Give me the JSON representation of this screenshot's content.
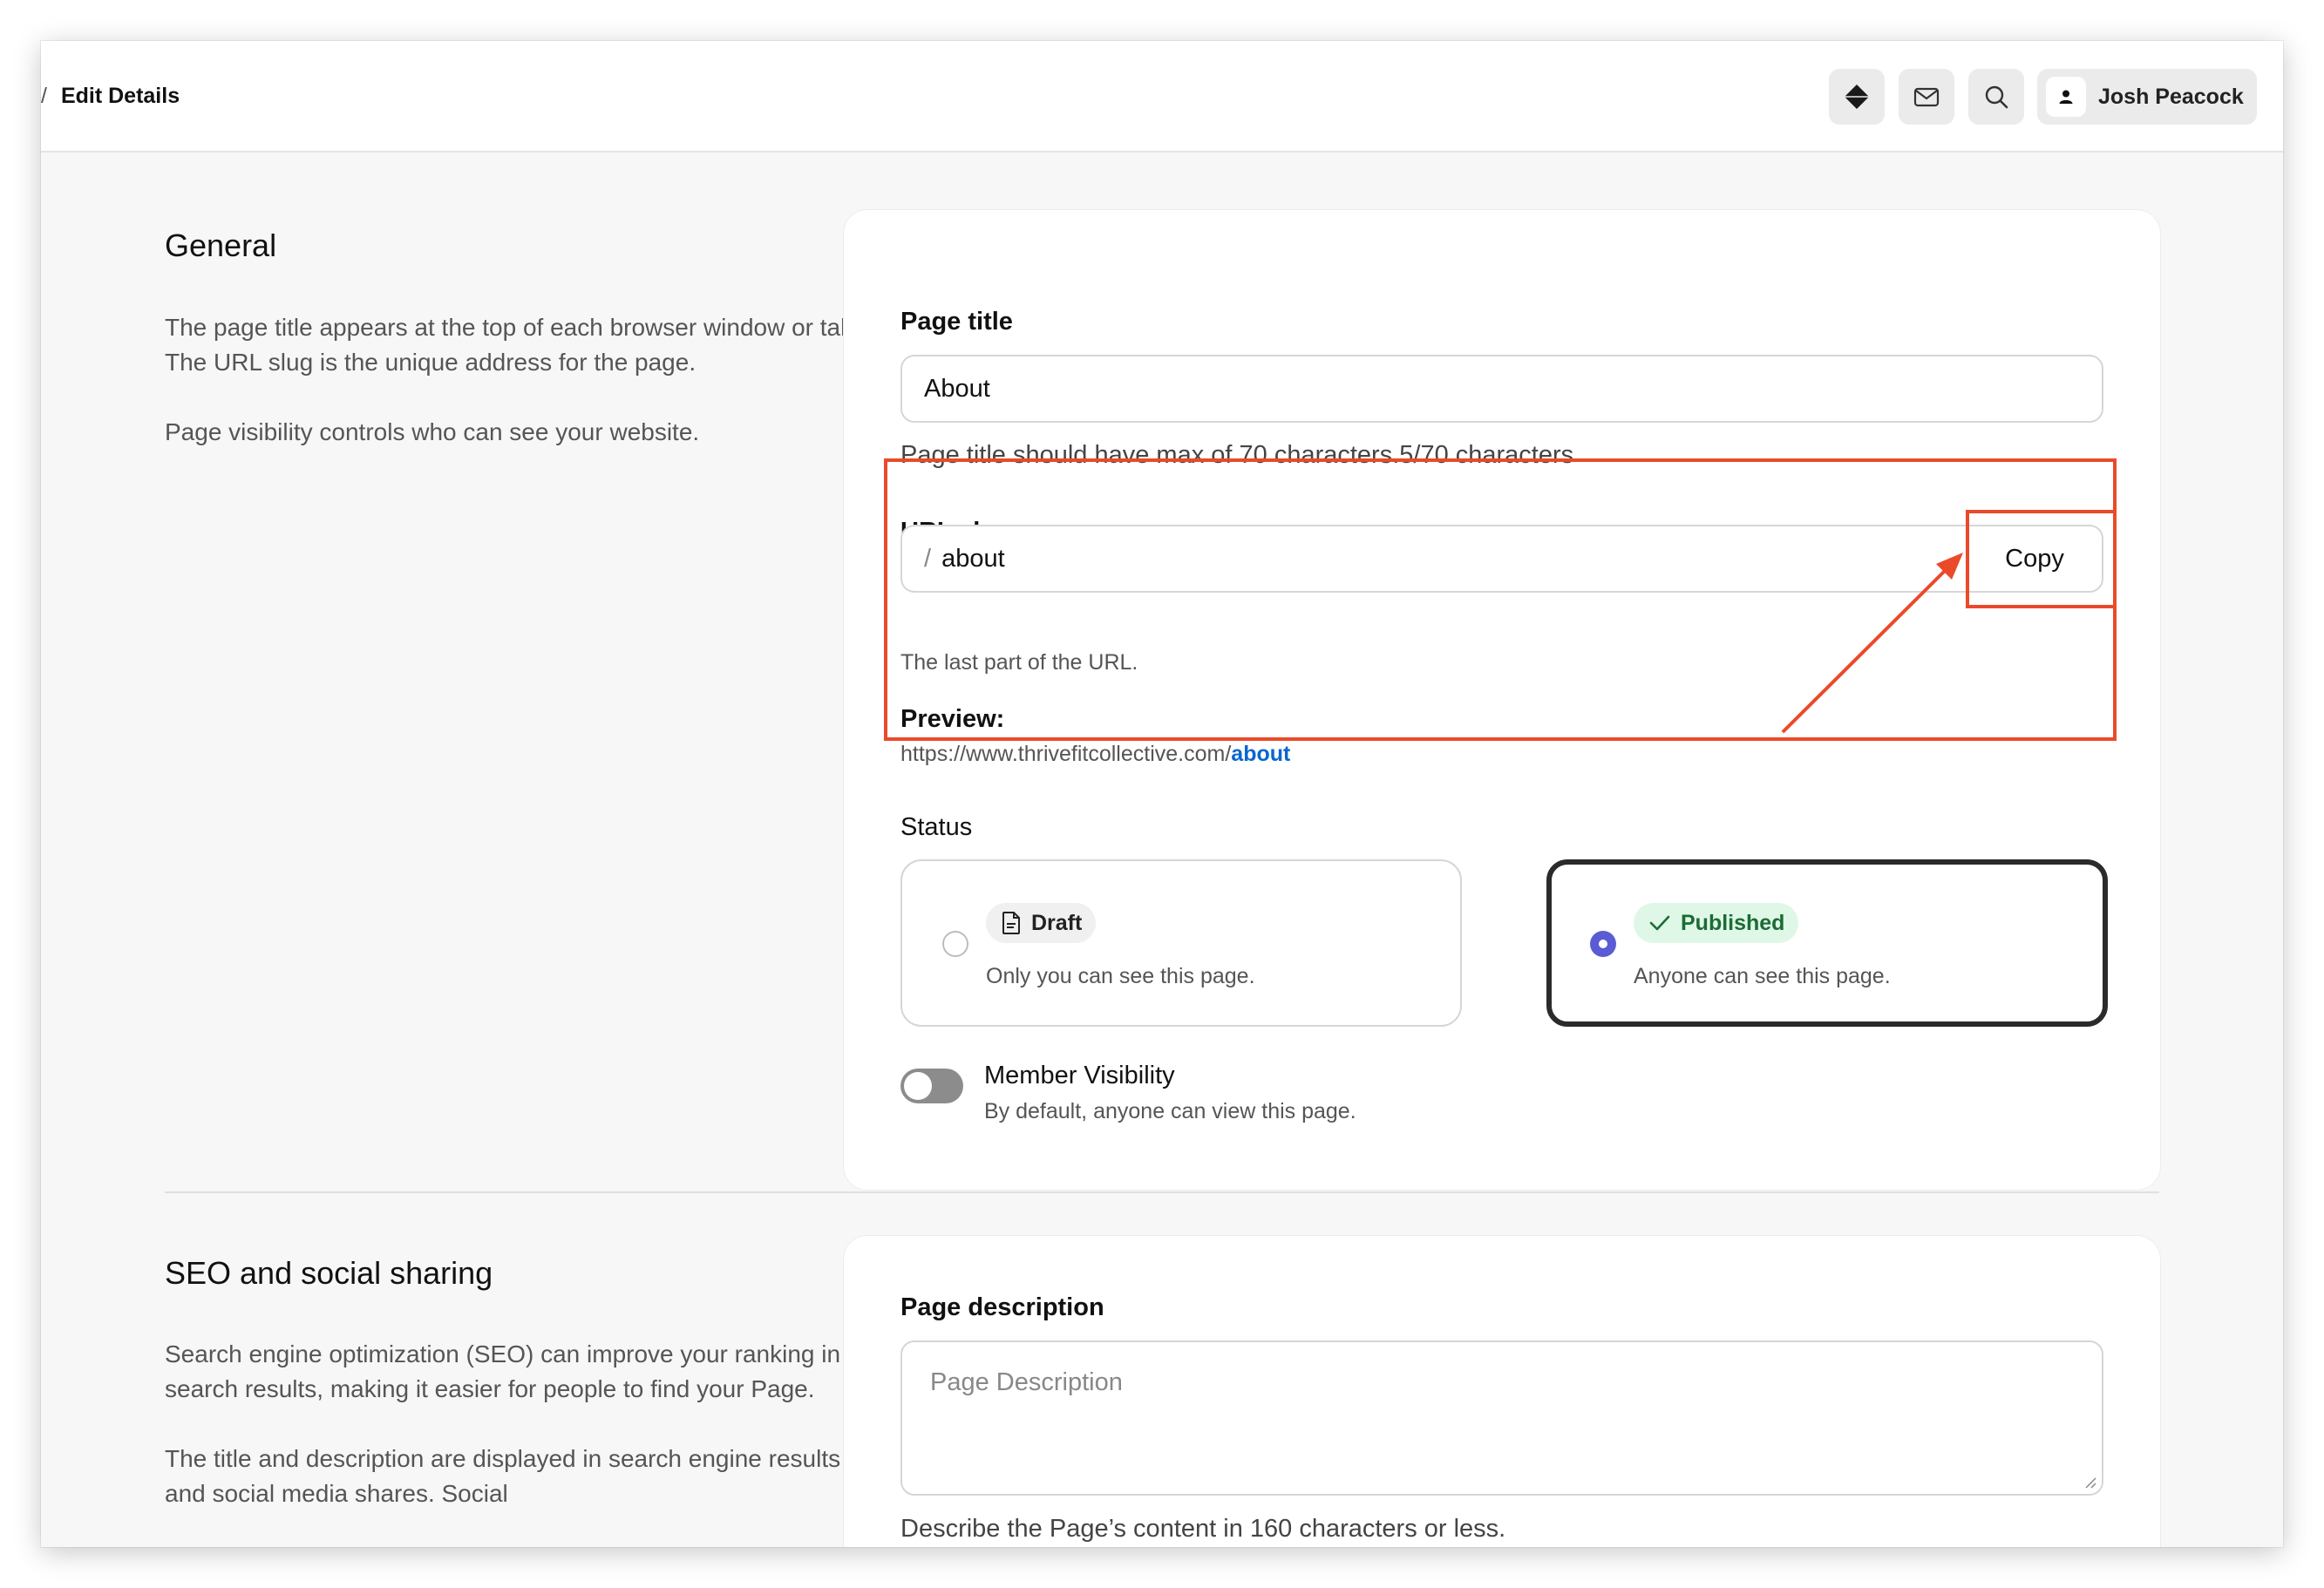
{
  "topbar": {
    "breadcrumb_sep": "/",
    "breadcrumb_current": "Edit Details",
    "icons": [
      "diamond-icon",
      "mail-icon",
      "search-icon",
      "user-icon"
    ],
    "user_name": "Josh Peacock"
  },
  "general": {
    "title": "General",
    "desc_1": "The page title appears at the top of each browser window or tab. The URL slug is the unique address for the page.",
    "desc_2": "Page visibility controls who can see your website.",
    "page_title_label": "Page title",
    "page_title_value": "About",
    "page_title_helper": "Page title should have max of 70 characters.5/70 characters",
    "url_slug_label": "URL slug",
    "url_slug_prefix": "/",
    "url_slug_value": "about",
    "copy_label": "Copy",
    "url_helper": "The last part of the URL.",
    "preview_label": "Preview:",
    "preview_base": "https://www.thrivefitcollective.com/",
    "preview_slug": "about",
    "status_label": "Status",
    "status_options": [
      {
        "label": "Draft",
        "desc": "Only you can see this page.",
        "selected": false
      },
      {
        "label": "Published",
        "desc": "Anyone can see this page.",
        "selected": true
      }
    ],
    "member_visibility_title": "Member Visibility",
    "member_visibility_desc": "By default, anyone can view this page.",
    "member_visibility_on": false
  },
  "seo": {
    "title": "SEO and social sharing",
    "desc_1": "Search engine optimization (SEO) can improve your ranking in search results, making it easier for people to find your Page.",
    "desc_2": "The title and description are displayed in search engine results and social media shares. Social",
    "page_description_label": "Page description",
    "page_description_placeholder": "Page Description",
    "page_description_helper": "Describe the Page’s content in 160 characters or less."
  },
  "colors": {
    "accent_radio": "#5b5bd6",
    "published_badge_bg": "#dff7e6",
    "link": "#0a66d1",
    "annotation": "#ea4a2a"
  }
}
